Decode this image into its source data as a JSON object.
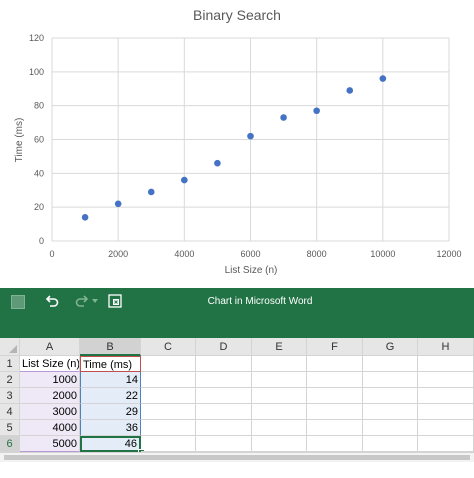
{
  "chart_data": {
    "type": "scatter",
    "title": "Binary Search",
    "xlabel": "List Size (n)",
    "ylabel": "Time (ms)",
    "xlim": [
      0,
      12000
    ],
    "ylim": [
      0,
      120
    ],
    "xticks": [
      "0",
      "2000",
      "4000",
      "6000",
      "8000",
      "10000",
      "12000"
    ],
    "yticks": [
      "0",
      "20",
      "40",
      "60",
      "80",
      "100",
      "120"
    ],
    "grid": true,
    "legend": "none",
    "marker_color": "#4472C4",
    "x": [
      1000,
      2000,
      3000,
      4000,
      5000,
      6000,
      7000,
      8000,
      9000,
      10000
    ],
    "y": [
      14,
      22,
      29,
      36,
      46,
      62,
      73,
      77,
      89,
      96
    ]
  },
  "ribbon": {
    "title": "Chart in Microsoft Word",
    "color": "#217346"
  },
  "sheet": {
    "columns": [
      "A",
      "B",
      "C",
      "D",
      "E",
      "F",
      "G",
      "H"
    ],
    "rows": [
      "1",
      "2",
      "3",
      "4",
      "5",
      "6"
    ],
    "cells": [
      [
        "List Size (n)",
        "Time (ms)"
      ],
      [
        "1000",
        "14"
      ],
      [
        "2000",
        "22"
      ],
      [
        "3000",
        "29"
      ],
      [
        "4000",
        "36"
      ],
      [
        "5000",
        "46"
      ]
    ]
  }
}
